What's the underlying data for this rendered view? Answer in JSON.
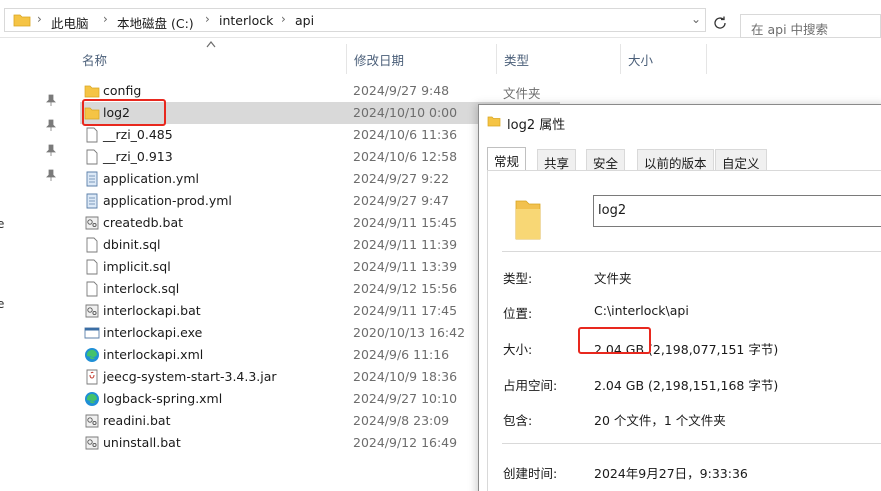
{
  "address_bar": {
    "crumbs": [
      "此电脑",
      "本地磁盘 (C:)",
      "interlock",
      "api"
    ],
    "search_placeholder": "在 api 中搜索"
  },
  "columns": {
    "name": "名称",
    "date": "修改日期",
    "type": "类型",
    "size": "大小"
  },
  "left_edge_glyphs": [
    "e",
    "e"
  ],
  "files": [
    {
      "name": "config",
      "date": "2024/9/27 9:48",
      "type": "文件夹",
      "icon": "folder-icon"
    },
    {
      "name": "log2",
      "date": "2024/10/10 0:00",
      "type": "",
      "icon": "folder-icon",
      "selected": true
    },
    {
      "name": "__rzi_0.485",
      "date": "2024/10/6 11:36",
      "type": "",
      "icon": "file-icon"
    },
    {
      "name": "__rzi_0.913",
      "date": "2024/10/6 12:58",
      "type": "",
      "icon": "file-icon"
    },
    {
      "name": "application.yml",
      "date": "2024/9/27 9:22",
      "type": "",
      "icon": "notepad-file-icon"
    },
    {
      "name": "application-prod.yml",
      "date": "2024/9/27 9:47",
      "type": "",
      "icon": "notepad-file-icon"
    },
    {
      "name": "createdb.bat",
      "date": "2024/9/11 15:45",
      "type": "",
      "icon": "batch-file-icon"
    },
    {
      "name": "dbinit.sql",
      "date": "2024/9/11 11:39",
      "type": "",
      "icon": "file-icon"
    },
    {
      "name": "implicit.sql",
      "date": "2024/9/11 13:39",
      "type": "",
      "icon": "file-icon"
    },
    {
      "name": "interlock.sql",
      "date": "2024/9/12 15:56",
      "type": "",
      "icon": "file-icon"
    },
    {
      "name": "interlockapi.bat",
      "date": "2024/9/11 17:45",
      "type": "",
      "icon": "batch-file-icon"
    },
    {
      "name": "interlockapi.exe",
      "date": "2020/10/13 16:42",
      "type": "",
      "icon": "exe-file-icon"
    },
    {
      "name": "interlockapi.xml",
      "date": "2024/9/6 11:16",
      "type": "",
      "icon": "edge-icon"
    },
    {
      "name": "jeecg-system-start-3.4.3.jar",
      "date": "2024/10/9 18:36",
      "type": "",
      "icon": "jar-file-icon"
    },
    {
      "name": "logback-spring.xml",
      "date": "2024/9/27 10:10",
      "type": "",
      "icon": "edge-icon"
    },
    {
      "name": "readini.bat",
      "date": "2024/9/8 23:09",
      "type": "",
      "icon": "batch-file-icon"
    },
    {
      "name": "uninstall.bat",
      "date": "2024/9/12 16:49",
      "type": "",
      "icon": "batch-file-icon"
    }
  ],
  "dialog": {
    "title": "log2 属性",
    "tabs": [
      "常规",
      "共享",
      "安全",
      "以前的版本",
      "自定义"
    ],
    "folder_name": "log2",
    "props": {
      "type_label": "类型:",
      "type_value": "文件夹",
      "location_label": "位置:",
      "location_value": "C:\\interlock\\api",
      "size_label": "大小:",
      "size_value": "2.04 GB (2,198,077,151 字节)",
      "disk_label": "占用空间:",
      "disk_value": "2.04 GB (2,198,151,168 字节)",
      "contains_label": "包含:",
      "contains_value": "20 个文件，1 个文件夹",
      "created_label": "创建时间:",
      "created_value": "2024年9月27日，9:33:36"
    }
  },
  "colors": {
    "highlight": "#e8281e",
    "selection": "#d9d9d9",
    "folder": "#f5c445"
  }
}
